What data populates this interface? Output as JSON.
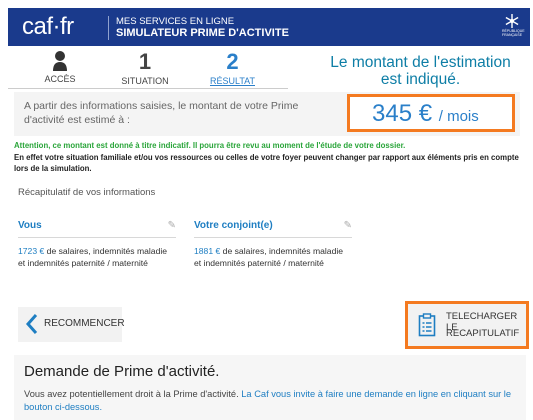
{
  "header": {
    "logo": "caf·fr",
    "line1": "MES SERVICES EN LIGNE",
    "line2": "SIMULATEUR PRIME D'ACTIVITE",
    "emblem_text": "RÉPUBLIQUE FRANÇAISE",
    "bg_color": "#1a3a8c"
  },
  "steps": [
    {
      "number": "",
      "label": "ACCÈS",
      "icon": "person-icon"
    },
    {
      "number": "1",
      "label": "SITUATION"
    },
    {
      "number": "2",
      "label": "RÉSULTAT",
      "active": true
    }
  ],
  "annotation": {
    "line1": "Le montant de l'estimation",
    "line2": "est indiqué."
  },
  "result": {
    "text": "A partir des informations saisies, le montant de votre Prime d'activité est estimé à :",
    "amount": "345 €",
    "unit": "/ mois",
    "highlight_color": "#f47a20"
  },
  "warning": "Attention, ce montant est donné à titre indicatif. Il pourra être revu au moment de l'étude de votre dossier.",
  "info": "En effet votre situation familiale et/ou vos ressources ou celles de votre foyer peuvent changer par rapport aux éléments pris en compte lors de la simulation.",
  "recap": {
    "title": "Récapitulatif de vos informations",
    "persons": [
      {
        "name": "Vous",
        "amount": "1723 €",
        "desc": " de salaires, indemnités maladie et indemnités paternité / maternité"
      },
      {
        "name": "Votre conjoint(e)",
        "amount": "1881 €",
        "desc": " de salaires, indemnités maladie et indemnités paternité / maternité"
      }
    ]
  },
  "buttons": {
    "restart": "RECOMMENCER",
    "download_line1": "TELECHARGER LE",
    "download_line2": "RECAPITULATIF"
  },
  "demande": {
    "title": "Demande de Prime d'activité.",
    "text": "Vous avez potentiellement droit à la Prime d'activité. ",
    "link_text": "La Caf vous invite à faire une demande en ligne en cliquant sur le bouton ci-dessous."
  }
}
